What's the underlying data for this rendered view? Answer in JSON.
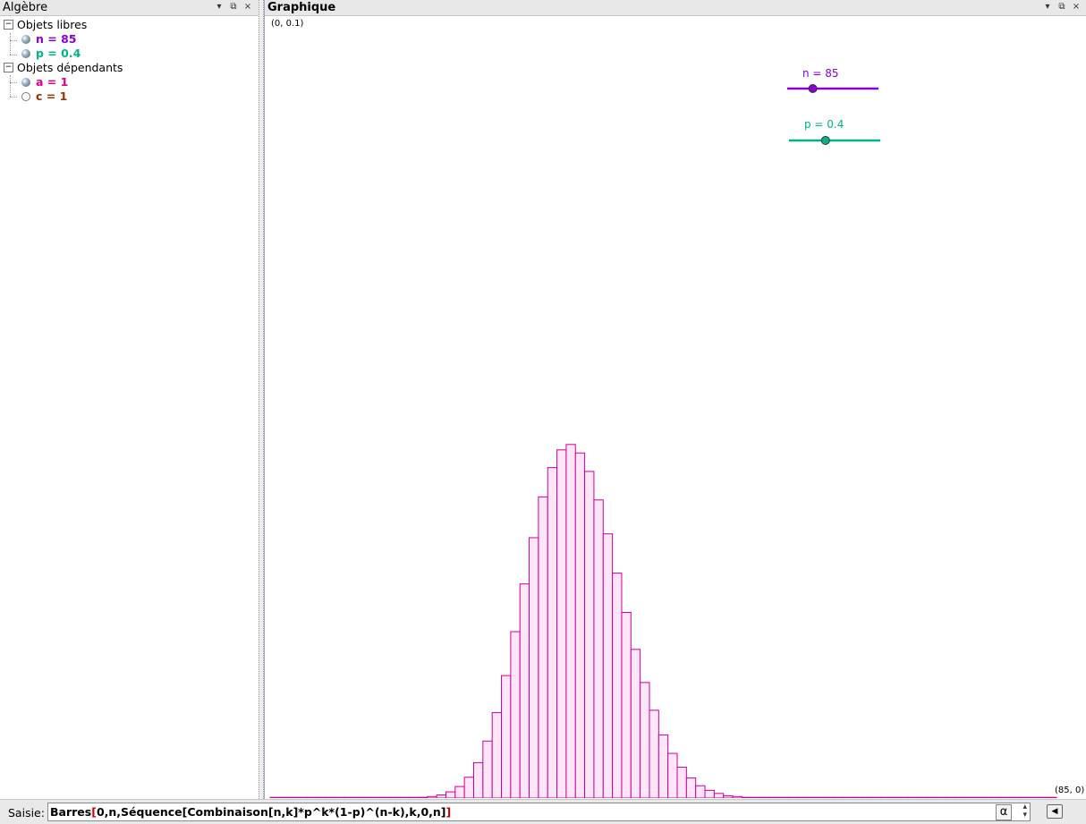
{
  "algebra": {
    "title": "Algèbre",
    "groups": [
      {
        "label": "Objets libres",
        "items": [
          {
            "text": "n = 85",
            "color": "#8a00d4",
            "marker": "filled"
          },
          {
            "text": "p = 0.4",
            "color": "#00b38a",
            "marker": "filled"
          }
        ]
      },
      {
        "label": "Objets dépendants",
        "items": [
          {
            "text": "a = 1",
            "color": "#e0008a",
            "marker": "filled"
          },
          {
            "text": "c = 1",
            "color": "#993300",
            "marker": "hollow"
          }
        ]
      }
    ]
  },
  "graphics": {
    "title": "Graphique",
    "corner_top_left": "(0, 0.1)",
    "corner_bottom_right": "(85, 0)",
    "sliders": [
      {
        "label": "n = 85",
        "color": "#8a00d4",
        "fraction": 0.28
      },
      {
        "label": "p = 0.4",
        "color": "#00b38a",
        "fraction": 0.4
      }
    ]
  },
  "header_icons": {
    "menu": "▾",
    "undock": "⧉",
    "close": "×"
  },
  "input": {
    "label": "Saisie:",
    "cmd": "Barres",
    "open": "[",
    "body": "0,n,Séquence[Combinaison[n,k]*p^k*(1-p)^(n-k),k,0,n]",
    "close": "]",
    "alpha": "α",
    "spinner": "▴▾",
    "help": "◀"
  },
  "chart_data": {
    "type": "bar",
    "n": 85,
    "p": 0.4,
    "xlim": [
      0,
      85
    ],
    "ylim": [
      0,
      0.1
    ],
    "bar_color": "#cc0099",
    "bar_fill": "#ffe6f6",
    "x": [
      0,
      1,
      2,
      3,
      4,
      5,
      6,
      7,
      8,
      9,
      10,
      11,
      12,
      13,
      14,
      15,
      16,
      17,
      18,
      19,
      20,
      21,
      22,
      23,
      24,
      25,
      26,
      27,
      28,
      29,
      30,
      31,
      32,
      33,
      34,
      35,
      36,
      37,
      38,
      39,
      40,
      41,
      42,
      43,
      44,
      45,
      46,
      47,
      48,
      49,
      50,
      51,
      52,
      53,
      54,
      55,
      56,
      57,
      58,
      59,
      60,
      61,
      62,
      63,
      64,
      65,
      66,
      67,
      68,
      69,
      70,
      71,
      72,
      73,
      74,
      75,
      76,
      77,
      78,
      79,
      80,
      81,
      82,
      83,
      84
    ],
    "values": [
      0,
      0,
      0,
      0,
      0,
      0,
      0,
      0,
      0,
      0,
      0,
      0,
      0,
      0,
      0,
      0,
      0.0001,
      0.0002,
      0.0004,
      0.0008,
      0.0015,
      0.0027,
      0.0046,
      0.0074,
      0.0111,
      0.0159,
      0.0216,
      0.0278,
      0.0338,
      0.0391,
      0.0429,
      0.0452,
      0.0459,
      0.0448,
      0.0424,
      0.0387,
      0.0343,
      0.0292,
      0.0241,
      0.0193,
      0.015,
      0.0114,
      0.0082,
      0.0058,
      0.004,
      0.0026,
      0.0016,
      0.001,
      0.0006,
      0.0003,
      0.0002,
      0.0001,
      0,
      0,
      0,
      0,
      0,
      0,
      0,
      0,
      0,
      0,
      0,
      0,
      0,
      0,
      0,
      0,
      0,
      0,
      0,
      0,
      0,
      0,
      0,
      0,
      0,
      0,
      0,
      0,
      0,
      0,
      0,
      0,
      0
    ]
  }
}
